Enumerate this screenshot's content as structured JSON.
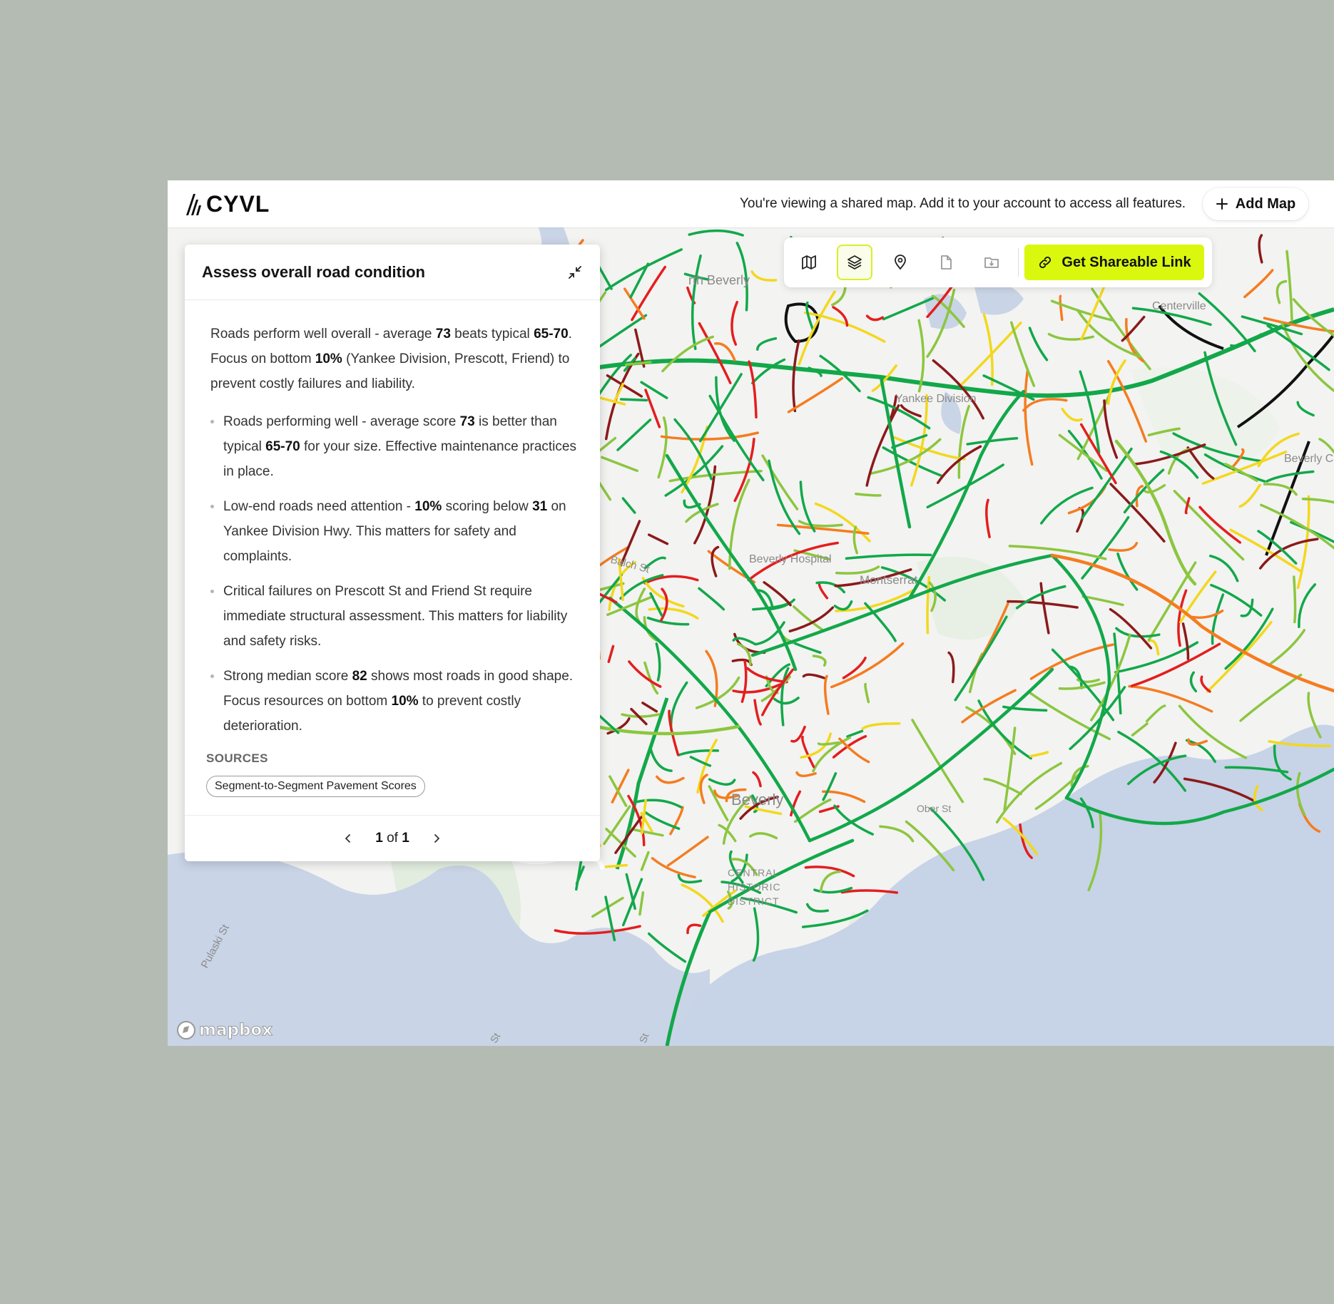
{
  "header": {
    "logo_text": "CYVL",
    "notice": "You're viewing a shared map. Add it to your account to access all features.",
    "add_map_label": "Add Map"
  },
  "toolbar": {
    "tools": [
      "map-icon",
      "layers-icon",
      "pin-icon",
      "file-icon",
      "folder-download-icon"
    ],
    "active_tool": "layers-icon",
    "share_label": "Get Shareable Link",
    "accent_color": "#d9f80e"
  },
  "panel": {
    "title": "Assess overall road condition",
    "summary": {
      "t1": "Roads perform well overall - average ",
      "b1": "73",
      "t2": " beats typical ",
      "b2": "65-70",
      "t3": ". Focus on bottom ",
      "b3": "10%",
      "t4": " (Yankee Division, Prescott, Friend) to prevent costly failures and liability."
    },
    "bullets": [
      {
        "t1": "Roads performing well - average score ",
        "b1": "73",
        "t2": " is better than typical ",
        "b2": "65-70",
        "t3": " for your size. Effective maintenance practices in place."
      },
      {
        "t1": "Low-end roads need attention - ",
        "b1": "10%",
        "t2": " scoring below ",
        "b2": "31",
        "t3": " on Yankee Division Hwy. This matters for safety and complaints."
      },
      {
        "t1": "Critical failures on Prescott St and Friend St require immediate structural assessment. This matters for liability and safety risks."
      },
      {
        "t1": "Strong median score ",
        "b1": "82",
        "t2": " shows most roads in good shape. Focus resources on bottom ",
        "b2": "10%",
        "t3": " to prevent costly deterioration."
      }
    ],
    "sources_label": "SOURCES",
    "source_chip": "Segment-to-Segment Pavement Scores",
    "pager": {
      "current": "1",
      "of": "of",
      "total": "1"
    }
  },
  "map": {
    "labels": {
      "north_beverly": "rth Beverly",
      "centerville": "Centerville",
      "yankee_division": "Yankee Division",
      "beverly_cove": "Beverly Co",
      "beverly_hospital": "Beverly Hospital",
      "montserrat": "Montserrat",
      "balch": "Balch St",
      "beverly": "Beverly",
      "district_1": "CENTRAL",
      "district_2": "HISTORIC",
      "district_3": "DISTRICT",
      "pulaski": "Pulaski St",
      "st_1": "St",
      "st_2": "St",
      "ober": "Ober St"
    },
    "attribution": "mapbox",
    "condition_colors": {
      "good": "#12a84a",
      "fair": "#8cc63f",
      "moderate": "#f2d81c",
      "poor": "#f57c1f",
      "bad": "#e31e1e",
      "failed": "#8b1a1a",
      "unrated": "#111111"
    }
  }
}
